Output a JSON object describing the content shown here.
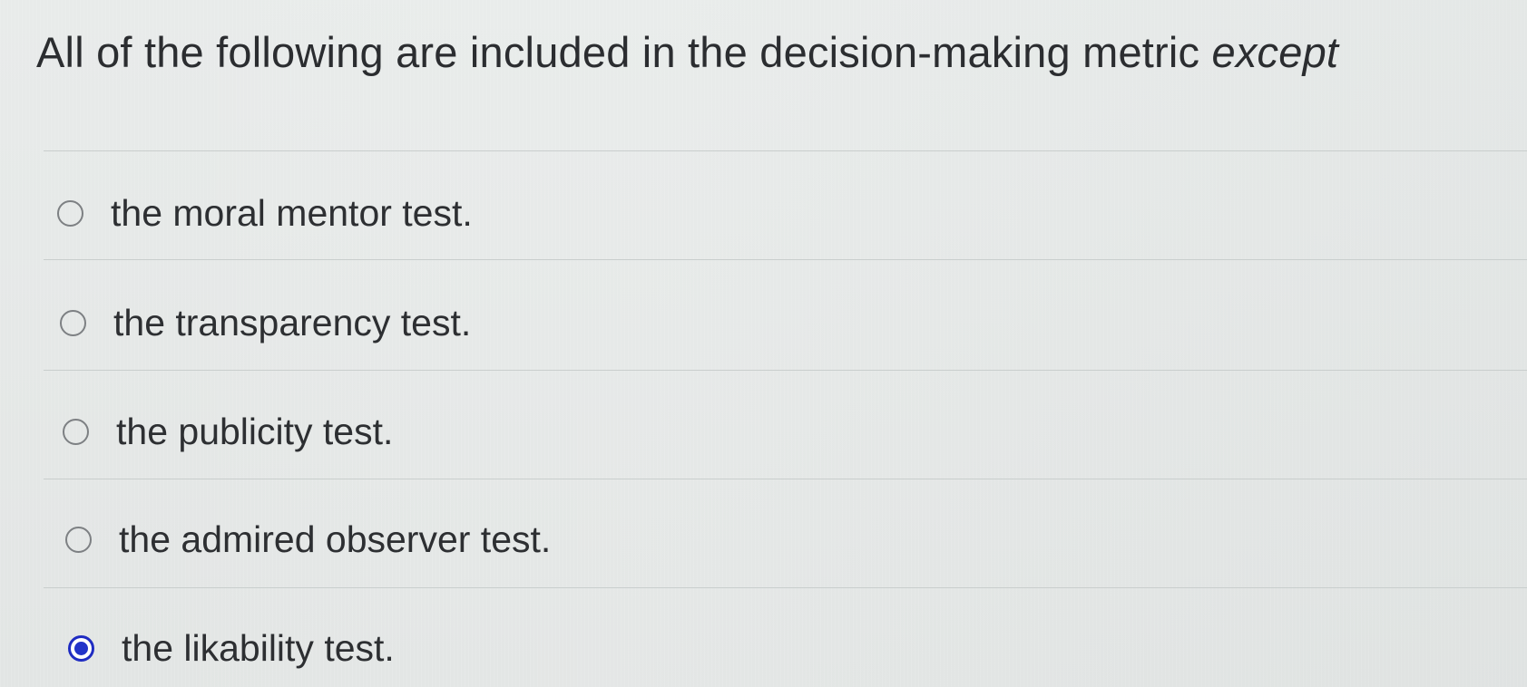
{
  "question": {
    "prefix": "All of the following are included in the decision-making metric ",
    "emphasis": "except"
  },
  "options": [
    {
      "label": "the moral mentor test.",
      "selected": false
    },
    {
      "label": "the transparency test.",
      "selected": false
    },
    {
      "label": "the publicity test.",
      "selected": false
    },
    {
      "label": "the admired observer test.",
      "selected": false
    },
    {
      "label": "the likability test.",
      "selected": true
    }
  ],
  "colors": {
    "selected_radio": "#2334c9",
    "text": "#2d2f32"
  }
}
